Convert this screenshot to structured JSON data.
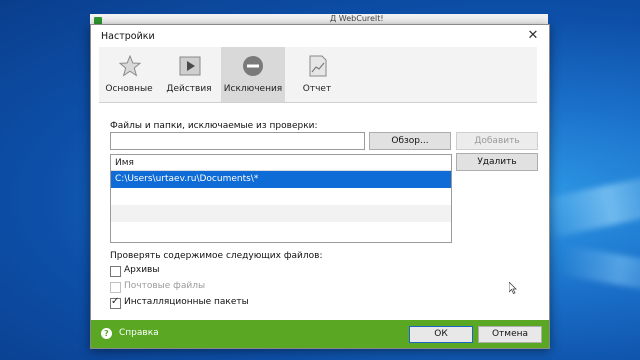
{
  "parent_window": {
    "title": "Д WebCureIt!"
  },
  "dialog": {
    "title": "Настройки",
    "close_label": "✕"
  },
  "tabs": [
    {
      "label": "Основные",
      "icon": "star-icon"
    },
    {
      "label": "Действия",
      "icon": "play-icon"
    },
    {
      "label": "Исключения",
      "icon": "minus-circle-icon",
      "active": true
    },
    {
      "label": "Отчет",
      "icon": "report-chart-icon"
    }
  ],
  "exclusions": {
    "section_label": "Файлы и папки, исключаемые из проверки:",
    "path_input_value": "",
    "browse_label": "Обзор...",
    "add_label": "Добавить",
    "remove_label": "Удалить",
    "list_header": "Имя",
    "items": [
      "C:\\Users\\urtaev.ru\\Documents\\*"
    ]
  },
  "file_check": {
    "section_label": "Проверять содержимое следующих файлов:",
    "options": [
      {
        "label": "Архивы",
        "checked": false,
        "enabled": true
      },
      {
        "label": "Почтовые файлы",
        "checked": false,
        "enabled": false
      },
      {
        "label": "Инсталляционные пакеты",
        "checked": true,
        "enabled": true
      }
    ]
  },
  "footer": {
    "help_label": "Справка",
    "ok_label": "ОК",
    "cancel_label": "Отмена",
    "accent": "#5aa723"
  }
}
